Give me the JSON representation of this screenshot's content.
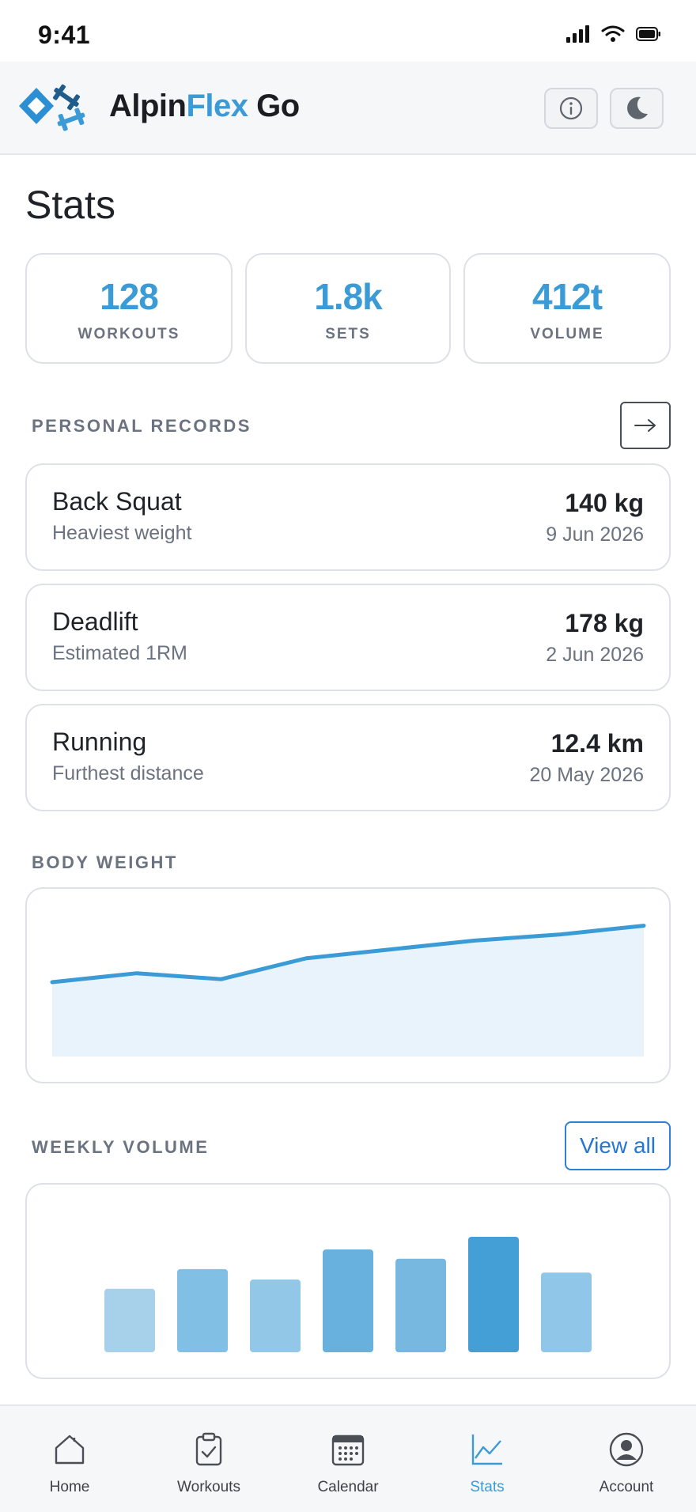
{
  "status_bar": {
    "time": "9:41"
  },
  "header": {
    "brand_part1": "Alpin",
    "brand_part2": "Flex",
    "brand_part3": " Go"
  },
  "page": {
    "title": "Stats"
  },
  "stats": [
    {
      "value": "128",
      "label": "WORKOUTS"
    },
    {
      "value": "1.8k",
      "label": "SETS"
    },
    {
      "value": "412t",
      "label": "VOLUME"
    }
  ],
  "personal_records": {
    "label": "PERSONAL RECORDS",
    "items": [
      {
        "name": "Back Squat",
        "subtitle": "Heaviest weight",
        "value": "140 kg",
        "date": "9 Jun 2026"
      },
      {
        "name": "Deadlift",
        "subtitle": "Estimated 1RM",
        "value": "178 kg",
        "date": "2 Jun 2026"
      },
      {
        "name": "Running",
        "subtitle": "Furthest distance",
        "value": "12.4 km",
        "date": "20 May 2026"
      }
    ]
  },
  "body_weight": {
    "label": "BODY WEIGHT"
  },
  "weekly_volume": {
    "label": "WEEKLY VOLUME",
    "view_all": "View all"
  },
  "chart_data": [
    {
      "type": "area",
      "x": [
        1,
        2,
        3,
        4,
        5,
        6,
        7,
        8
      ],
      "values": [
        50,
        56,
        52,
        66,
        72,
        78,
        82,
        88
      ],
      "ylim": [
        0,
        100
      ],
      "color": "#3b9bd6",
      "fill": "#e9f3fb"
    },
    {
      "type": "bar",
      "x": [
        1,
        2,
        3,
        4,
        5,
        6,
        7
      ],
      "values": [
        55,
        72,
        63,
        89,
        81,
        100,
        69
      ],
      "ylim": [
        0,
        100
      ],
      "colors": [
        "#a7d0eb",
        "#82bfe4",
        "#93c7e8",
        "#68b0de",
        "#77b8e1",
        "#449fd6",
        "#90c6e8"
      ]
    }
  ],
  "tabs": [
    {
      "label": "Home",
      "icon": "home-icon"
    },
    {
      "label": "Workouts",
      "icon": "clipboard-check-icon"
    },
    {
      "label": "Calendar",
      "icon": "calendar-icon"
    },
    {
      "label": "Stats",
      "icon": "chart-line-icon",
      "active": true
    },
    {
      "label": "Account",
      "icon": "user-circle-icon"
    }
  ],
  "colors": {
    "accent": "#3b9bd6",
    "link": "#2576d4"
  }
}
